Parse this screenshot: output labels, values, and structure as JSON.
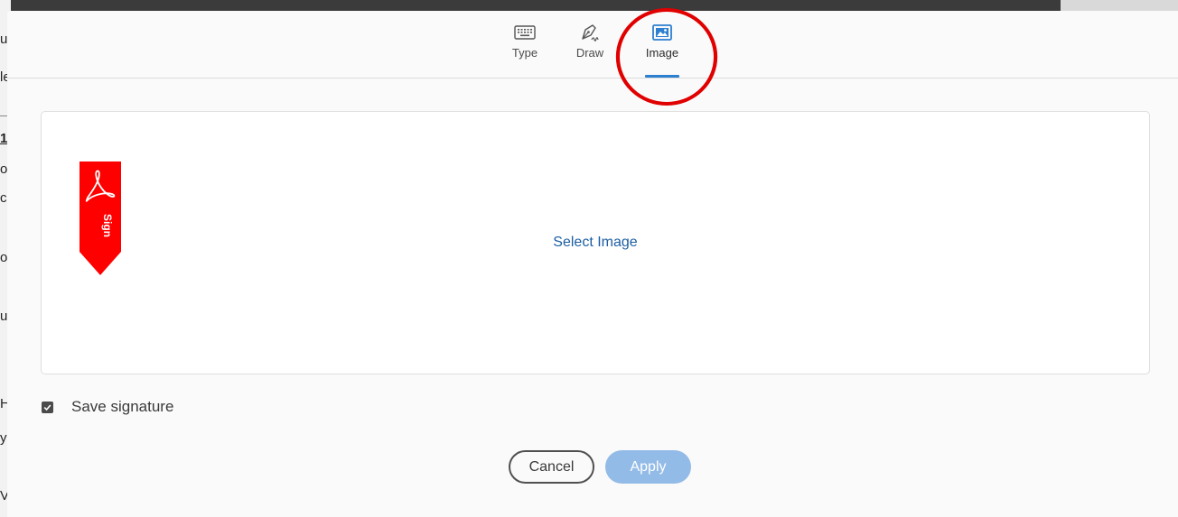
{
  "tabs": [
    {
      "label": "Type",
      "icon": "keyboard-icon"
    },
    {
      "label": "Draw",
      "icon": "pen-nib-icon"
    },
    {
      "label": "Image",
      "icon": "image-icon",
      "active": true
    }
  ],
  "canvas": {
    "select_image_label": "Select Image",
    "badge_label": "Sign",
    "badge_icon": "acrobat-logo-icon"
  },
  "save_signature": {
    "label": "Save signature",
    "checked": true
  },
  "buttons": {
    "cancel_label": "Cancel",
    "apply_label": "Apply"
  },
  "colors": {
    "accent": "#2d7fd0",
    "link": "#1e5fa3",
    "apply_disabled": "#93bbe7",
    "sign_badge": "#ff0000",
    "annotation_circle": "#e00000"
  }
}
